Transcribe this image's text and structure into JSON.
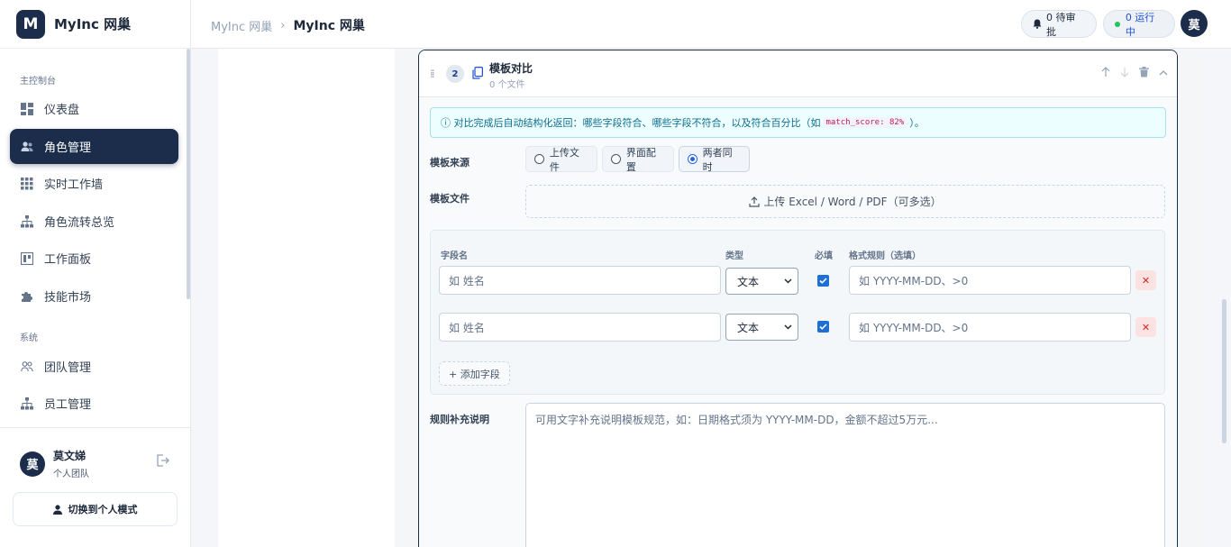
{
  "app": {
    "logo_letter": "M",
    "name": "MyInc 网巢"
  },
  "sidebar": {
    "section_main": "主控制台",
    "section_system": "系统",
    "items": [
      {
        "label": "仪表盘",
        "icon": "dashboard-icon"
      },
      {
        "label": "角色管理",
        "icon": "users-icon",
        "active": true
      },
      {
        "label": "实时工作墙",
        "icon": "grid-icon"
      },
      {
        "label": "角色流转总览",
        "icon": "flow-icon"
      },
      {
        "label": "工作面板",
        "icon": "board-icon"
      },
      {
        "label": "技能市场",
        "icon": "puzzle-icon"
      }
    ],
    "system_items": [
      {
        "label": "团队管理",
        "icon": "team-icon"
      },
      {
        "label": "员工管理",
        "icon": "org-icon"
      }
    ],
    "user": {
      "avatar": "莫",
      "name": "莫文娣",
      "team": "个人团队"
    },
    "switch_label": "切换到个人模式"
  },
  "header": {
    "breadcrumb_root": "MyInc 网巢",
    "breadcrumb_current": "MyInc 网巢",
    "pending_label": "0 待审批",
    "running_label": "0 运行中",
    "avatar": "莫"
  },
  "card": {
    "step": "2",
    "title": "模板对比",
    "subtitle": "0 个文件",
    "info_prefix": "ⓘ 对比完成后自动结构化返回：哪些字段符合、哪些字段不符合，以及符合百分比（如",
    "info_code": "match_score: 82%",
    "info_suffix": "）。",
    "source_label": "模板来源",
    "source_options": [
      "上传文件",
      "界面配置",
      "两者同时"
    ],
    "source_selected": "两者同时",
    "file_label": "模板文件",
    "upload_label": "上传 Excel / Word / PDF（可多选）",
    "fields": {
      "col_name": "字段名",
      "col_type": "类型",
      "col_required": "必填",
      "col_rule": "格式规则（选填）",
      "rows": [
        {
          "name_placeholder": "如 姓名",
          "type": "文本",
          "required": true,
          "rule_placeholder": "如 YYYY-MM-DD、>0"
        },
        {
          "name_placeholder": "如 姓名",
          "type": "文本",
          "required": true,
          "rule_placeholder": "如 YYYY-MM-DD、>0"
        }
      ],
      "add_label": "+ 添加字段"
    },
    "rules_label": "规则补充说明",
    "rules_placeholder": "可用文字补充说明模板规范，如：日期格式须为 YYYY-MM-DD，金额不超过5万元..."
  },
  "colors": {
    "primary": "#1b2d4b",
    "accent_blue": "#1d6fd6",
    "success": "#22c55e",
    "danger": "#dc2626"
  }
}
